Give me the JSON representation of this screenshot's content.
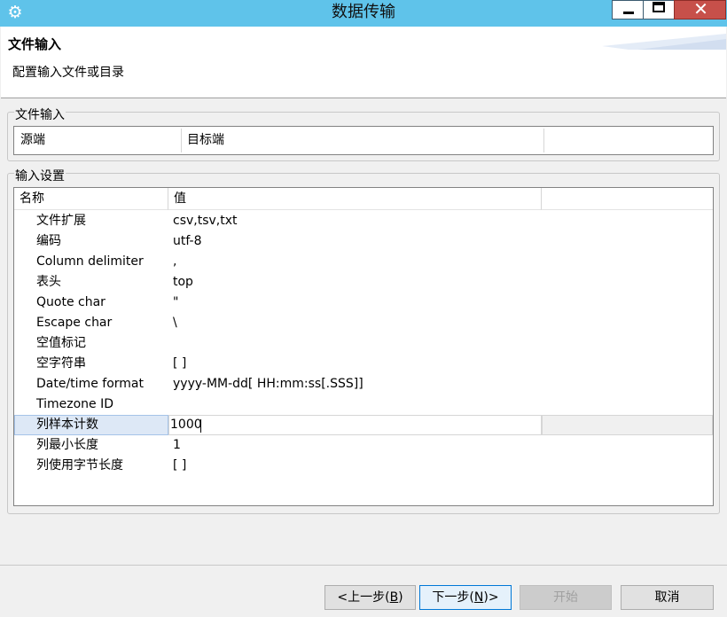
{
  "window": {
    "title": "数据传输",
    "app_icon": "gear-icon",
    "accent_color": "#5fc3ea",
    "close_color": "#c7504a"
  },
  "header": {
    "title": "文件输入",
    "description": "配置输入文件或目录"
  },
  "file_input_group": {
    "label": "文件输入",
    "columns": [
      "源端",
      "目标端",
      ""
    ]
  },
  "settings_group": {
    "label": "输入设置",
    "columns": [
      "名称",
      "值"
    ],
    "rows": [
      {
        "name": "文件扩展",
        "value": "csv,tsv,txt"
      },
      {
        "name": "编码",
        "value": "utf-8"
      },
      {
        "name": "Column delimiter",
        "value": ","
      },
      {
        "name": "表头",
        "value": "top"
      },
      {
        "name": "Quote char",
        "value": "\""
      },
      {
        "name": "Escape char",
        "value": "\\"
      },
      {
        "name": "空值标记",
        "value": ""
      },
      {
        "name": "空字符串",
        "value": "[ ]"
      },
      {
        "name": "Date/time format",
        "value": "yyyy-MM-dd[ HH:mm:ss[.SSS]]"
      },
      {
        "name": "Timezone ID",
        "value": ""
      },
      {
        "name": "列样本计数",
        "value": "1000"
      },
      {
        "name": "列最小长度",
        "value": "1"
      },
      {
        "name": "列使用字节长度",
        "value": "[ ]"
      }
    ],
    "selected_row": 10
  },
  "buttons": {
    "back": {
      "label": "<上一步(",
      "mnemonic": "B",
      "suffix": ")"
    },
    "next": {
      "label": "下一步(",
      "mnemonic": "N",
      "suffix": ")>"
    },
    "start": {
      "label": "开始"
    },
    "cancel": {
      "label": "取消"
    }
  }
}
